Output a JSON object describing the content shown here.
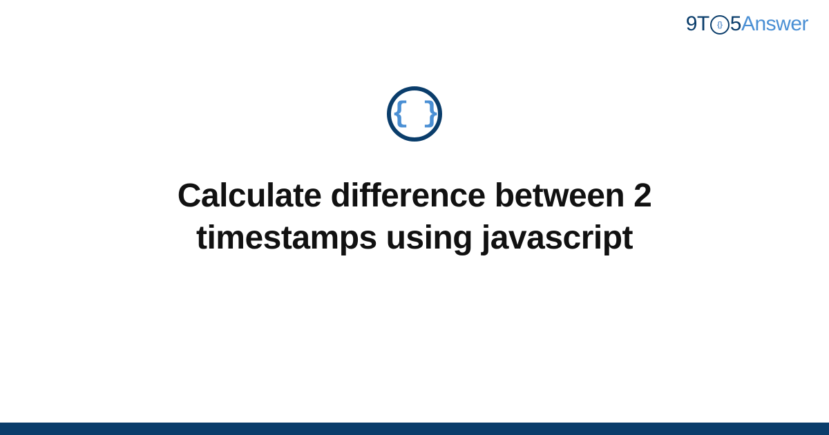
{
  "header": {
    "logo": {
      "part1": "9T",
      "o_inner": "{}",
      "part2": "5",
      "part3": "Answer"
    }
  },
  "main": {
    "icon_name": "code-braces-icon",
    "icon_glyph": "{ }",
    "title": "Calculate difference between 2 timestamps using javascript"
  },
  "colors": {
    "brand_dark": "#0a3d6b",
    "brand_light": "#4a8fd4",
    "text": "#111111",
    "background": "#ffffff"
  }
}
